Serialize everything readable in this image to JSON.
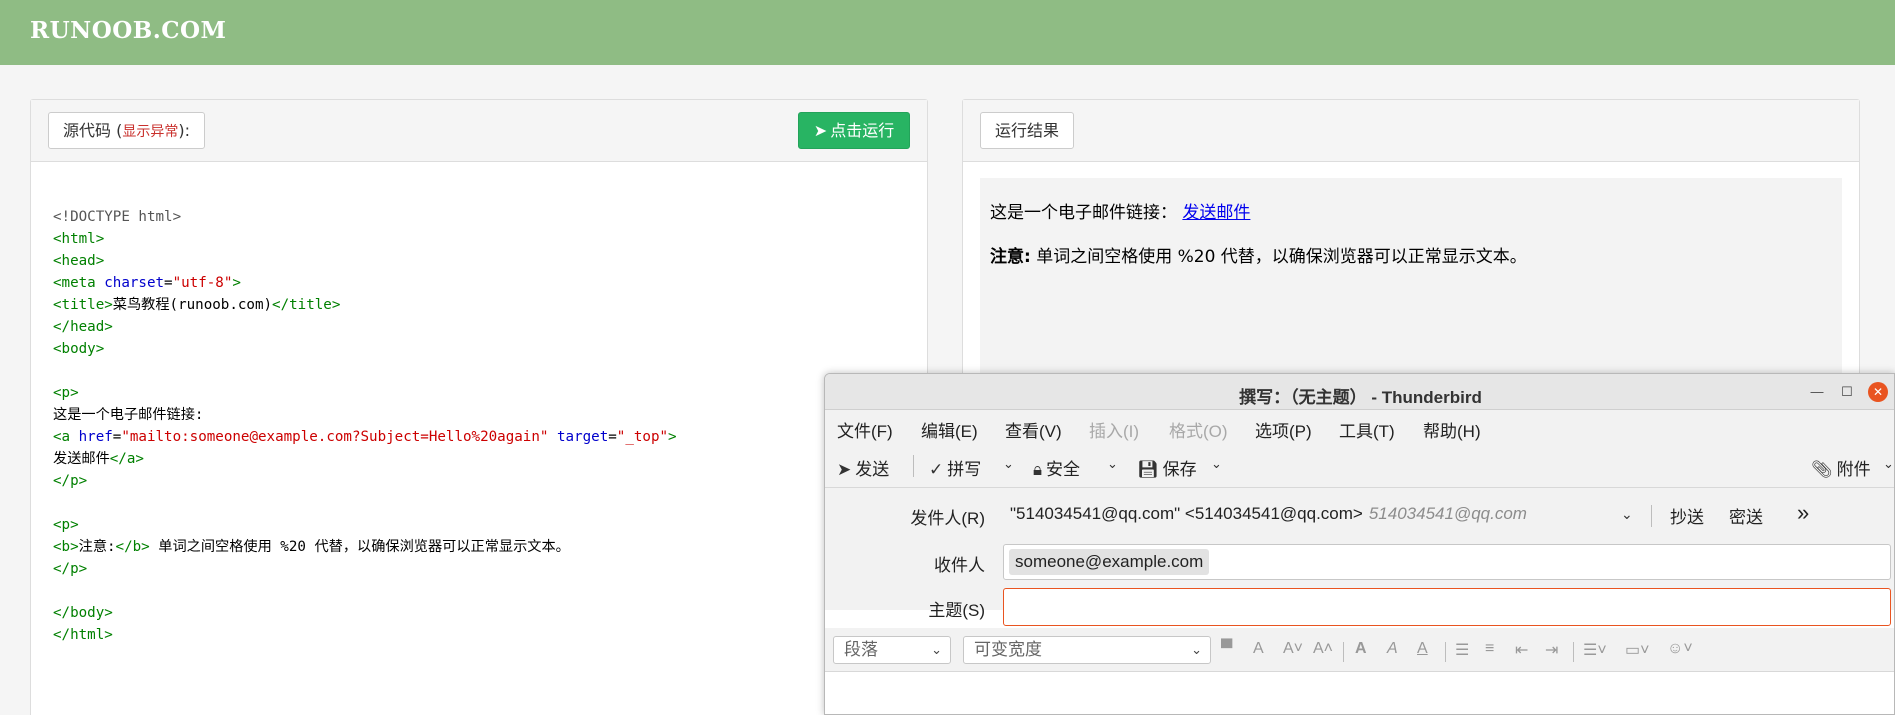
{
  "site": {
    "logo": "RUNOOB.COM"
  },
  "editor": {
    "tab_label": "源代码 (",
    "tab_warn": "显示异常",
    "tab_suffix": "):",
    "run_label": "点击运行",
    "run_icon": "paper-plane-icon"
  },
  "result": {
    "tab_label": "运行结果",
    "line1": "这是一个电子邮件链接：",
    "link_text": "发送邮件",
    "note_bold": "注意:",
    "note_text": " 单词之间空格使用 %20 代替，以确保浏览器可以正常显示文本。"
  },
  "thunderbird": {
    "title": "撰写：（无主题） - Thunderbird",
    "menu": [
      "文件(F)",
      "编辑(E)",
      "查看(V)",
      "插入(I)",
      "格式(O)",
      "选项(P)",
      "工具(T)",
      "帮助(H)"
    ],
    "toolbar": {
      "send": "发送",
      "spell": "拼写",
      "security": "安全",
      "save": "保存",
      "attach": "附件"
    },
    "from_label": "发件人(R)",
    "from_value": "\"514034541@qq.com\" <514034541@qq.com>",
    "from_hint": "514034541@qq.com",
    "cc": "抄送",
    "bcc": "密送",
    "to_label": "收件人",
    "to_value": "someone@example.com",
    "subject_label": "主题(S)",
    "subject_value": "",
    "paragraph_select": "段落",
    "font_select": "可变宽度"
  }
}
